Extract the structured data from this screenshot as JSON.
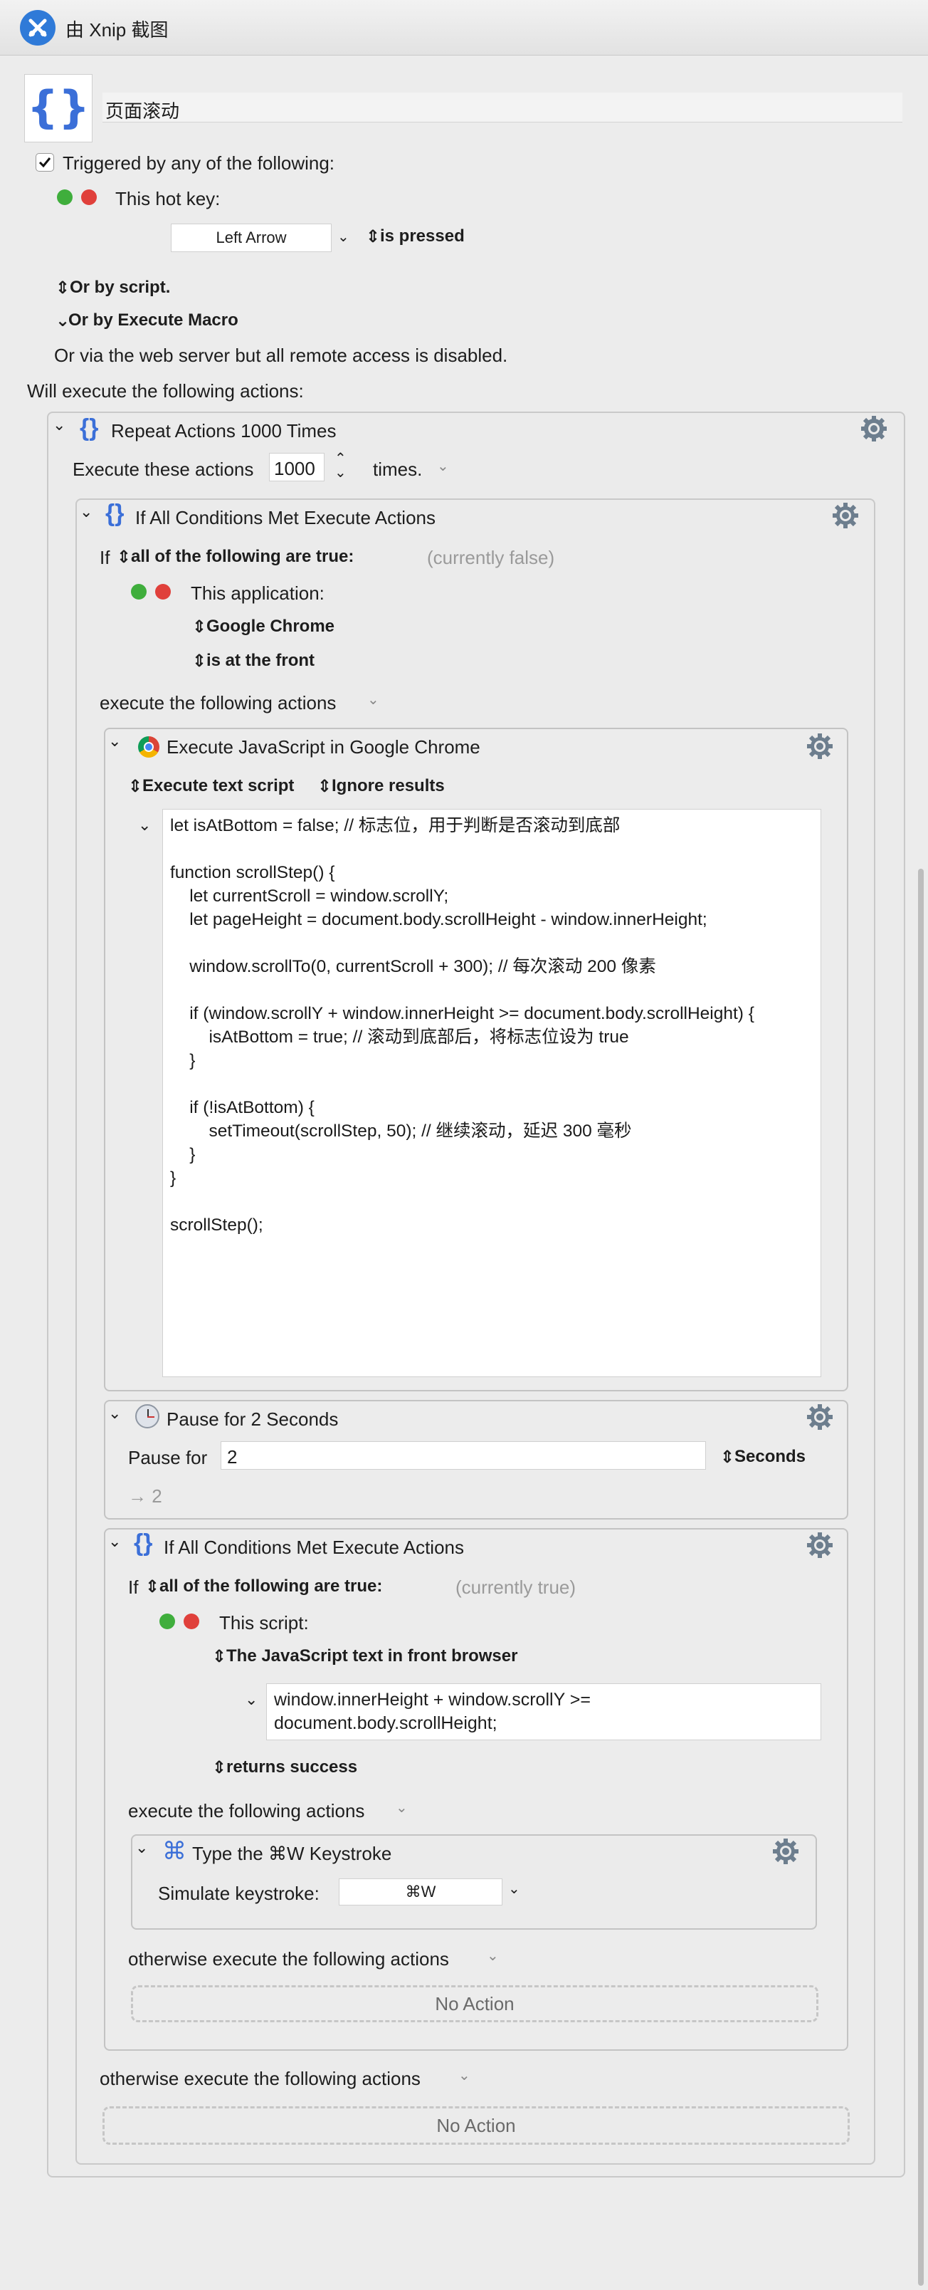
{
  "window": {
    "title": "由 Xnip 截图"
  },
  "macro": {
    "name": "页面滚动"
  },
  "triggers": {
    "header": "Triggered by any of the following:",
    "hotkey_label": "This hot key:",
    "hotkey_value": "Left Arrow",
    "hotkey_state": "is pressed",
    "or_script": "Or by script.",
    "or_execute_macro": "Or by Execute Macro",
    "web_server": "Or via the web server but all remote access is disabled."
  },
  "will_execute": "Will execute the following actions:",
  "repeat": {
    "title": "Repeat Actions 1000 Times",
    "execute_label": "Execute these actions",
    "count": "1000",
    "times_label": "times."
  },
  "if1": {
    "title": "If All Conditions Met Execute Actions",
    "if_label": "If",
    "condition": "all of the following are true:",
    "status": "(currently false)",
    "app_label": "This application:",
    "app_name": "Google Chrome",
    "app_state": "is at the front",
    "execute_label": "execute the following actions",
    "otherwise_label": "otherwise execute the following actions",
    "no_action": "No Action"
  },
  "js": {
    "title": "Execute JavaScript in Google Chrome",
    "mode": "Execute text script",
    "results": "Ignore results",
    "code": [
      "let isAtBottom = false; // 标志位，用于判断是否滚动到底部",
      "",
      "function scrollStep() {",
      "    let currentScroll = window.scrollY;",
      "    let pageHeight = document.body.scrollHeight - window.innerHeight;",
      "",
      "    window.scrollTo(0, currentScroll + 300); // 每次滚动 200 像素",
      "",
      "    if (window.scrollY + window.innerHeight >= document.body.scrollHeight) {",
      "        isAtBottom = true; // 滚动到底部后，将标志位设为 true",
      "    }",
      "",
      "    if (!isAtBottom) {",
      "        setTimeout(scrollStep, 50); // 继续滚动，延迟 300 毫秒",
      "    }",
      "}",
      "",
      "scrollStep();"
    ]
  },
  "pause": {
    "title": "Pause for 2 Seconds",
    "label": "Pause for",
    "value": "2",
    "unit": "Seconds",
    "result": "→ 2"
  },
  "if2": {
    "title": "If All Conditions Met Execute Actions",
    "if_label": "If",
    "condition": "all of the following are true:",
    "status": "(currently true)",
    "script_label": "This script:",
    "script_type": "The JavaScript text in front browser",
    "script_text": "window.innerHeight + window.scrollY >= document.body.scrollHeight;",
    "script_result": "returns success",
    "execute_label": "execute the following actions",
    "otherwise_label": "otherwise execute the following actions",
    "no_action": "No Action"
  },
  "keystroke": {
    "title": "Type the ⌘W Keystroke",
    "label": "Simulate keystroke:",
    "value": "⌘W"
  },
  "colors": {
    "accent_blue": "#3b6fd8",
    "gear": "#6d7e8e",
    "plus": "#3fae3c",
    "minus": "#e0403b"
  }
}
